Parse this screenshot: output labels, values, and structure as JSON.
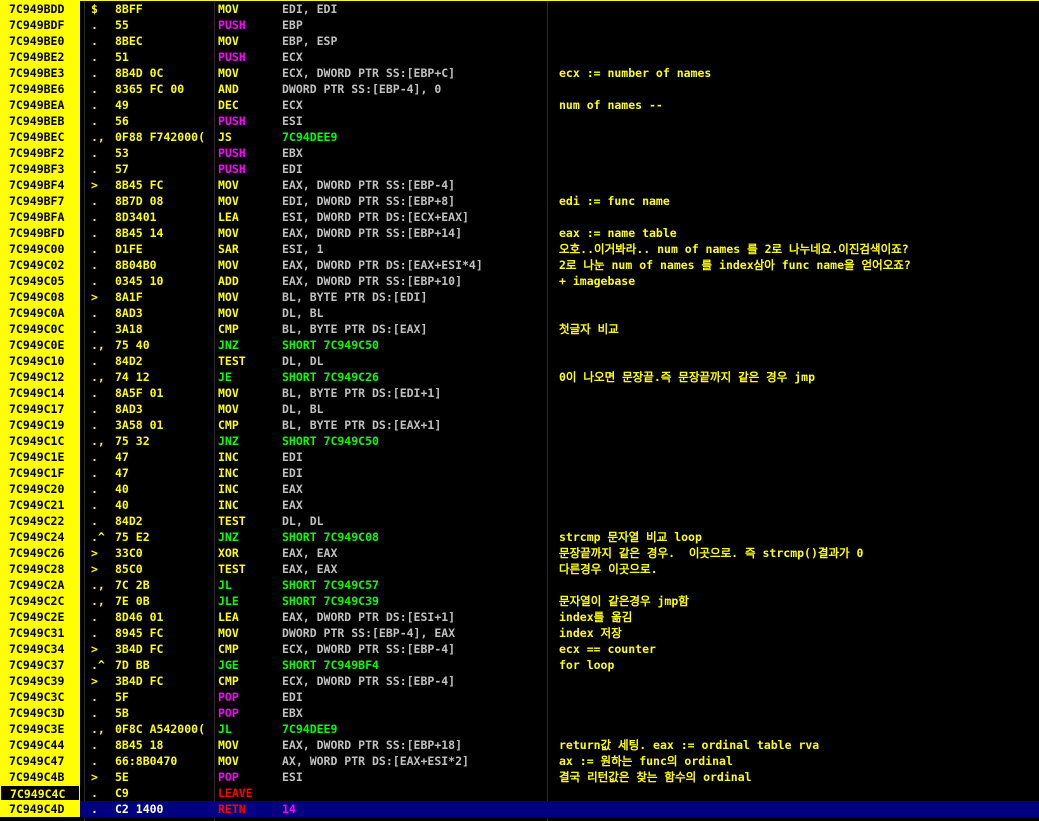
{
  "palette": {
    "mov": "#ffff00",
    "push": "#ff00ff",
    "pop": "#ff00ff",
    "jump": "#00ff00",
    "call_ret": "#ff0000",
    "arith": "#ffff00",
    "operand": "#c0c0c0",
    "number": "#ff00ff",
    "jump_target": "#00ff00"
  },
  "rows": [
    {
      "addr": "7C949BDD",
      "flag": "$",
      "hex": "8BFF",
      "mnem": "MOV",
      "ops": "EDI, EDI",
      "cmt": "",
      "cls": "mov",
      "opcls": "operand"
    },
    {
      "addr": "7C949BDF",
      "flag": ".",
      "hex": "55",
      "mnem": "PUSH",
      "ops": "EBP",
      "cmt": "",
      "cls": "push",
      "opcls": "operand"
    },
    {
      "addr": "7C949BE0",
      "flag": ".",
      "hex": "8BEC",
      "mnem": "MOV",
      "ops": "EBP, ESP",
      "cmt": "",
      "cls": "mov",
      "opcls": "operand"
    },
    {
      "addr": "7C949BE2",
      "flag": ".",
      "hex": "51",
      "mnem": "PUSH",
      "ops": "ECX",
      "cmt": "",
      "cls": "push",
      "opcls": "operand"
    },
    {
      "addr": "7C949BE3",
      "flag": ".",
      "hex": "8B4D 0C",
      "mnem": "MOV",
      "ops": "ECX, DWORD PTR SS:[EBP+C]",
      "cmt": "ecx := number of names",
      "cls": "mov",
      "opcls": "operand"
    },
    {
      "addr": "7C949BE6",
      "flag": ".",
      "hex": "8365 FC 00",
      "mnem": "AND",
      "ops": "DWORD PTR SS:[EBP-4], 0",
      "cmt": "",
      "cls": "arith",
      "opcls": "operand"
    },
    {
      "addr": "7C949BEA",
      "flag": ".",
      "hex": "49",
      "mnem": "DEC",
      "ops": "ECX",
      "cmt": "num of names --",
      "cls": "arith",
      "opcls": "operand"
    },
    {
      "addr": "7C949BEB",
      "flag": ".",
      "hex": "56",
      "mnem": "PUSH",
      "ops": "ESI",
      "cmt": "",
      "cls": "push",
      "opcls": "operand"
    },
    {
      "addr": "7C949BEC",
      "flag": ".,",
      "hex": "0F88 F742000(",
      "mnem": "JS",
      "ops": "7C94DEE9",
      "cmt": "",
      "cls": "arith",
      "opcls": "jump_target"
    },
    {
      "addr": "7C949BF2",
      "flag": ".",
      "hex": "53",
      "mnem": "PUSH",
      "ops": "EBX",
      "cmt": "",
      "cls": "push",
      "opcls": "operand"
    },
    {
      "addr": "7C949BF3",
      "flag": ".",
      "hex": "57",
      "mnem": "PUSH",
      "ops": "EDI",
      "cmt": "",
      "cls": "push",
      "opcls": "operand"
    },
    {
      "addr": "7C949BF4",
      "flag": ">",
      "hex": "8B45 FC",
      "mnem": "MOV",
      "ops": "EAX, DWORD PTR SS:[EBP-4]",
      "cmt": "",
      "cls": "mov",
      "opcls": "operand"
    },
    {
      "addr": "7C949BF7",
      "flag": ".",
      "hex": "8B7D 08",
      "mnem": "MOV",
      "ops": "EDI, DWORD PTR SS:[EBP+8]",
      "cmt": "edi := func name",
      "cls": "mov",
      "opcls": "operand"
    },
    {
      "addr": "7C949BFA",
      "flag": ".",
      "hex": "8D3401",
      "mnem": "LEA",
      "ops": "ESI, DWORD PTR DS:[ECX+EAX]",
      "cmt": "",
      "cls": "mov",
      "opcls": "operand"
    },
    {
      "addr": "7C949BFD",
      "flag": ".",
      "hex": "8B45 14",
      "mnem": "MOV",
      "ops": "EAX, DWORD PTR SS:[EBP+14]",
      "cmt": "eax := name table",
      "cls": "mov",
      "opcls": "operand"
    },
    {
      "addr": "7C949C00",
      "flag": ".",
      "hex": "D1FE",
      "mnem": "SAR",
      "ops": "ESI, 1",
      "cmt": "오호..이거봐라.. num of names 를 2로 나누네요.이진검색이죠?",
      "cls": "arith",
      "opcls": "operand"
    },
    {
      "addr": "7C949C02",
      "flag": ".",
      "hex": "8B04B0",
      "mnem": "MOV",
      "ops": "EAX, DWORD PTR DS:[EAX+ESI*4]",
      "cmt": "2로 나눈 num of names 를 index삼아 func name을 얻어오죠?",
      "cls": "mov",
      "opcls": "operand"
    },
    {
      "addr": "7C949C05",
      "flag": ".",
      "hex": "0345 10",
      "mnem": "ADD",
      "ops": "EAX, DWORD PTR SS:[EBP+10]",
      "cmt": "+ imagebase",
      "cls": "arith",
      "opcls": "operand"
    },
    {
      "addr": "7C949C08",
      "flag": ">",
      "hex": "8A1F",
      "mnem": "MOV",
      "ops": "BL, BYTE PTR DS:[EDI]",
      "cmt": "",
      "cls": "mov",
      "opcls": "operand"
    },
    {
      "addr": "7C949C0A",
      "flag": ".",
      "hex": "8AD3",
      "mnem": "MOV",
      "ops": "DL, BL",
      "cmt": "",
      "cls": "mov",
      "opcls": "operand"
    },
    {
      "addr": "7C949C0C",
      "flag": ".",
      "hex": "3A18",
      "mnem": "CMP",
      "ops": "BL, BYTE PTR DS:[EAX]",
      "cmt": "첫글자 비교",
      "cls": "arith",
      "opcls": "operand"
    },
    {
      "addr": "7C949C0E",
      "flag": ".,",
      "hex": "75 40",
      "mnem": "JNZ",
      "ops": "SHORT 7C949C50",
      "cmt": "",
      "cls": "jump",
      "opcls": "jump_target"
    },
    {
      "addr": "7C949C10",
      "flag": ".",
      "hex": "84D2",
      "mnem": "TEST",
      "ops": "DL, DL",
      "cmt": "",
      "cls": "arith",
      "opcls": "operand"
    },
    {
      "addr": "7C949C12",
      "flag": ".,",
      "hex": "74 12",
      "mnem": "JE",
      "ops": "SHORT 7C949C26",
      "cmt": "0이 나오면 문장끝.즉 문장끝까지 같은 경우 jmp",
      "cls": "jump",
      "opcls": "jump_target"
    },
    {
      "addr": "7C949C14",
      "flag": ".",
      "hex": "8A5F 01",
      "mnem": "MOV",
      "ops": "BL, BYTE PTR DS:[EDI+1]",
      "cmt": "",
      "cls": "mov",
      "opcls": "operand"
    },
    {
      "addr": "7C949C17",
      "flag": ".",
      "hex": "8AD3",
      "mnem": "MOV",
      "ops": "DL, BL",
      "cmt": "",
      "cls": "mov",
      "opcls": "operand"
    },
    {
      "addr": "7C949C19",
      "flag": ".",
      "hex": "3A58 01",
      "mnem": "CMP",
      "ops": "BL, BYTE PTR DS:[EAX+1]",
      "cmt": "",
      "cls": "arith",
      "opcls": "operand"
    },
    {
      "addr": "7C949C1C",
      "flag": ".,",
      "hex": "75 32",
      "mnem": "JNZ",
      "ops": "SHORT 7C949C50",
      "cmt": "",
      "cls": "jump",
      "opcls": "jump_target"
    },
    {
      "addr": "7C949C1E",
      "flag": ".",
      "hex": "47",
      "mnem": "INC",
      "ops": "EDI",
      "cmt": "",
      "cls": "arith",
      "opcls": "operand"
    },
    {
      "addr": "7C949C1F",
      "flag": ".",
      "hex": "47",
      "mnem": "INC",
      "ops": "EDI",
      "cmt": "",
      "cls": "arith",
      "opcls": "operand"
    },
    {
      "addr": "7C949C20",
      "flag": ".",
      "hex": "40",
      "mnem": "INC",
      "ops": "EAX",
      "cmt": "",
      "cls": "arith",
      "opcls": "operand"
    },
    {
      "addr": "7C949C21",
      "flag": ".",
      "hex": "40",
      "mnem": "INC",
      "ops": "EAX",
      "cmt": "",
      "cls": "arith",
      "opcls": "operand"
    },
    {
      "addr": "7C949C22",
      "flag": ".",
      "hex": "84D2",
      "mnem": "TEST",
      "ops": "DL, DL",
      "cmt": "",
      "cls": "arith",
      "opcls": "operand"
    },
    {
      "addr": "7C949C24",
      "flag": ".^",
      "hex": "75 E2",
      "mnem": "JNZ",
      "ops": "SHORT 7C949C08",
      "cmt": "strcmp 문자열 비교 loop",
      "cls": "jump",
      "opcls": "jump_target"
    },
    {
      "addr": "7C949C26",
      "flag": ">",
      "hex": "33C0",
      "mnem": "XOR",
      "ops": "EAX, EAX",
      "cmt": "문장끝까지 같은 경우.  이곳으로. 즉 strcmp()결과가 0",
      "cls": "arith",
      "opcls": "operand"
    },
    {
      "addr": "7C949C28",
      "flag": ">",
      "hex": "85C0",
      "mnem": "TEST",
      "ops": "EAX, EAX",
      "cmt": "다른경우 이곳으로.",
      "cls": "arith",
      "opcls": "operand"
    },
    {
      "addr": "7C949C2A",
      "flag": ".,",
      "hex": "7C 2B",
      "mnem": "JL",
      "ops": "SHORT 7C949C57",
      "cmt": "",
      "cls": "jump",
      "opcls": "jump_target"
    },
    {
      "addr": "7C949C2C",
      "flag": ".,",
      "hex": "7E 0B",
      "mnem": "JLE",
      "ops": "SHORT 7C949C39",
      "cmt": "문자열이 같은경우 jmp함",
      "cls": "jump",
      "opcls": "jump_target"
    },
    {
      "addr": "7C949C2E",
      "flag": ".",
      "hex": "8D46 01",
      "mnem": "LEA",
      "ops": "EAX, DWORD PTR DS:[ESI+1]",
      "cmt": "index를 옮김",
      "cls": "mov",
      "opcls": "operand"
    },
    {
      "addr": "7C949C31",
      "flag": ".",
      "hex": "8945 FC",
      "mnem": "MOV",
      "ops": "DWORD PTR SS:[EBP-4], EAX",
      "cmt": "index 저장",
      "cls": "mov",
      "opcls": "operand"
    },
    {
      "addr": "7C949C34",
      "flag": ">",
      "hex": "3B4D FC",
      "mnem": "CMP",
      "ops": "ECX, DWORD PTR SS:[EBP-4]",
      "cmt": "ecx == counter",
      "cls": "arith",
      "opcls": "operand"
    },
    {
      "addr": "7C949C37",
      "flag": ".^",
      "hex": "7D BB",
      "mnem": "JGE",
      "ops": "SHORT 7C949BF4",
      "cmt": "for loop",
      "cls": "jump",
      "opcls": "jump_target"
    },
    {
      "addr": "7C949C39",
      "flag": ">",
      "hex": "3B4D FC",
      "mnem": "CMP",
      "ops": "ECX, DWORD PTR SS:[EBP-4]",
      "cmt": "",
      "cls": "arith",
      "opcls": "operand"
    },
    {
      "addr": "7C949C3C",
      "flag": ".",
      "hex": "5F",
      "mnem": "POP",
      "ops": "EDI",
      "cmt": "",
      "cls": "pop",
      "opcls": "operand"
    },
    {
      "addr": "7C949C3D",
      "flag": ".",
      "hex": "5B",
      "mnem": "POP",
      "ops": "EBX",
      "cmt": "",
      "cls": "pop",
      "opcls": "operand"
    },
    {
      "addr": "7C949C3E",
      "flag": ".,",
      "hex": "0F8C A542000(",
      "mnem": "JL",
      "ops": "7C94DEE9",
      "cmt": "",
      "cls": "jump",
      "opcls": "jump_target"
    },
    {
      "addr": "7C949C44",
      "flag": ".",
      "hex": "8B45 18",
      "mnem": "MOV",
      "ops": "EAX, DWORD PTR SS:[EBP+18]",
      "cmt": "return값 세팅. eax := ordinal table rva",
      "cls": "mov",
      "opcls": "operand"
    },
    {
      "addr": "7C949C47",
      "flag": ".",
      "hex": "66:8B0470",
      "mnem": "MOV",
      "ops": "AX, WORD PTR DS:[EAX+ESI*2]",
      "cmt": "ax := 원하는 func의 ordinal",
      "cls": "mov",
      "opcls": "operand"
    },
    {
      "addr": "7C949C4B",
      "flag": ">",
      "hex": "5E",
      "mnem": "POP",
      "ops": "ESI",
      "cmt": "결국 리턴값은 찾는 함수의 ordinal",
      "cls": "pop",
      "opcls": "operand"
    },
    {
      "addr": "7C949C4C",
      "flag": ".",
      "hex": "C9",
      "mnem": "LEAVE",
      "ops": "",
      "cmt": "",
      "cls": "call_ret",
      "opcls": "operand",
      "state": "highlight"
    },
    {
      "addr": "7C949C4D",
      "flag": ".",
      "hex": "C2 1400",
      "mnem": "RETN",
      "ops": "14",
      "cmt": "",
      "cls": "call_ret",
      "opcls": "number",
      "state": "selected"
    }
  ]
}
